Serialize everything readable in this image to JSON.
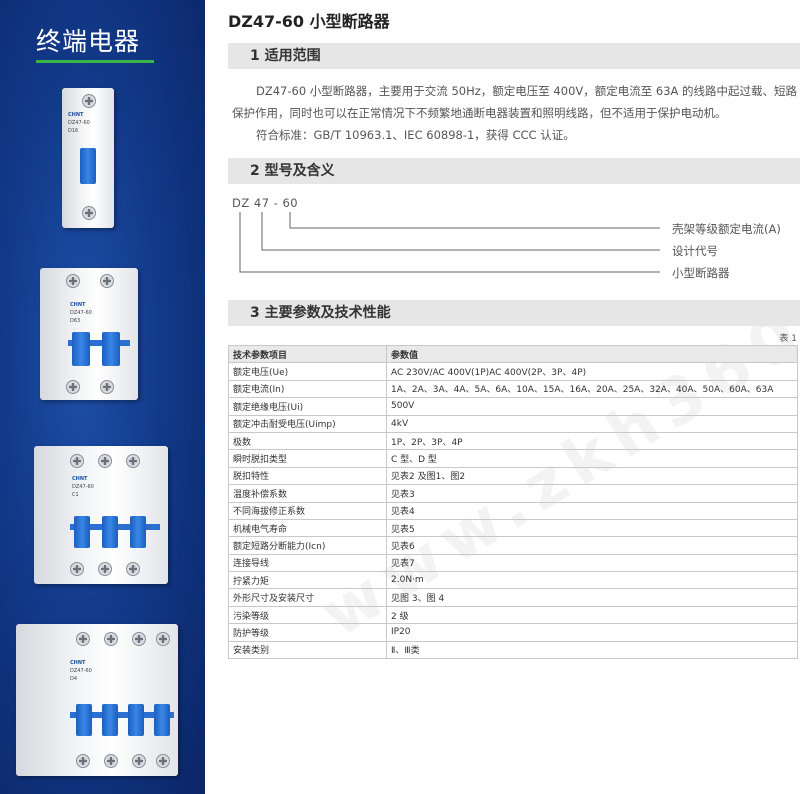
{
  "sidebar": {
    "brand": "终端电器",
    "products": [
      {
        "brand": "CHNT",
        "model": "DZ47-60",
        "rating": "D16"
      },
      {
        "brand": "CHNT",
        "model": "DZ47-60",
        "rating": "D63"
      },
      {
        "brand": "CHNT",
        "model": "DZ47-60",
        "rating": "C1"
      },
      {
        "brand": "CHNT",
        "model": "DZ47-60",
        "rating": "D4"
      }
    ]
  },
  "doc": {
    "title": "DZ47-60 小型断路器",
    "section1": {
      "heading": "1 适用范围",
      "para1": "DZ47-60 小型断路器，主要用于交流 50Hz，额定电压至 400V，额定电流至 63A 的线路中起过载、短路保护作用，同时也可以在正常情况下不频繁地通断电器装置和照明线路，但不适用于保护电动机。",
      "para2": "符合标准：GB/T 10963.1、IEC 60898-1，获得 CCC 认证。"
    },
    "section2": {
      "heading": "2 型号及含义",
      "code": "DZ 47 - 60",
      "labels": [
        "壳架等级额定电流(A)",
        "设计代号",
        "小型断路器"
      ]
    },
    "section3": {
      "heading": "3 主要参数及技术性能",
      "table_note": "表 1",
      "headers": [
        "技术参数项目",
        "参数值"
      ],
      "rows": [
        [
          "额定电压(Ue)",
          "AC 230V/AC 400V(1P)AC 400V(2P、3P、4P)"
        ],
        [
          "额定电流(In)",
          "1A、2A、3A、4A、5A、6A、10A、15A、16A、20A、25A、32A、40A、50A、60A、63A"
        ],
        [
          "额定绝缘电压(Ui)",
          "500V"
        ],
        [
          "额定冲击耐受电压(Uimp)",
          "4kV"
        ],
        [
          "极数",
          "1P、2P、3P、4P"
        ],
        [
          "瞬时脱扣类型",
          "C 型、D 型"
        ],
        [
          "脱扣特性",
          "见表2 及图1、图2"
        ],
        [
          "温度补偿系数",
          "见表3"
        ],
        [
          "不同海拔修正系数",
          "见表4"
        ],
        [
          "机械电气寿命",
          "见表5"
        ],
        [
          "额定短路分断能力(Icn)",
          "见表6"
        ],
        [
          "连接导线",
          "见表7"
        ],
        [
          "拧紧力矩",
          "2.0N·m"
        ],
        [
          "外形尺寸及安装尺寸",
          "见图 3、图 4"
        ],
        [
          "污染等级",
          "2 级"
        ],
        [
          "防护等级",
          "IP20"
        ],
        [
          "安装类别",
          "Ⅱ、Ⅲ类"
        ]
      ]
    }
  },
  "watermark": "www.zkh360.com"
}
